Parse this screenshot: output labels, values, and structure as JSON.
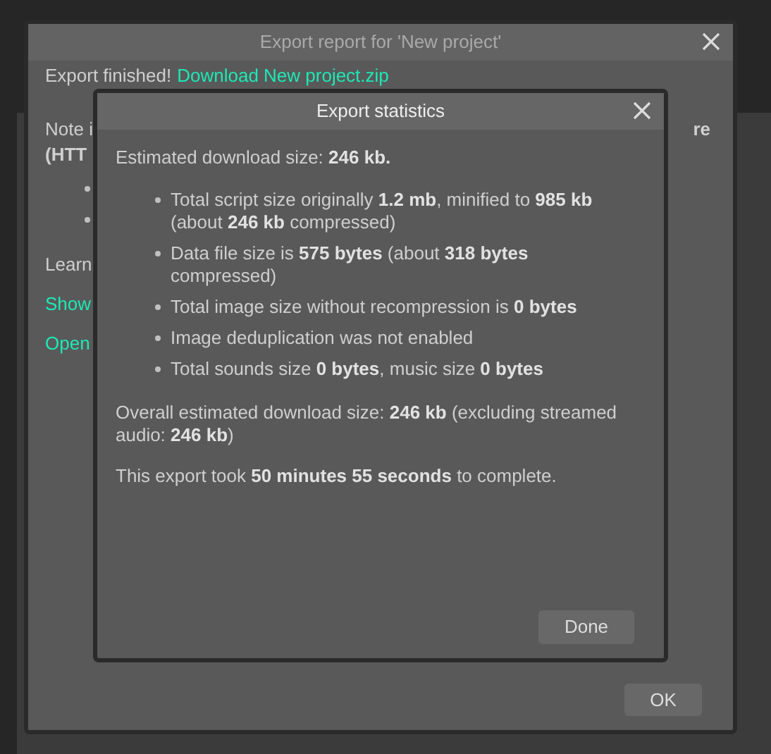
{
  "background_window": {
    "title": "Export report for 'New project'",
    "finished_text": "Export finished!",
    "download_link": "Download New project.zip",
    "note_left": "Note i",
    "note_right": "re",
    "note_line2": "(HTT",
    "learn_text": "Learn",
    "links": [
      "Show",
      "Open"
    ],
    "ok_button": "OK"
  },
  "dialog": {
    "title": "Export statistics",
    "estimate": "Estimated download size: **246 kb.**",
    "bullets": [
      "Total script size originally **1.2 mb**, minified to **985 kb** (about **246 kb** compressed)",
      "Data file size is **575 bytes** (about **318 bytes** compressed)",
      "Total image size without recompression is **0 bytes**",
      "Image deduplication was not enabled",
      "Total sounds size **0 bytes**, music size **0 bytes**"
    ],
    "overall": "Overall estimated download size: **246 kb** (excluding streamed audio: **246 kb**)",
    "duration": "This export took **50 minutes 55 seconds** to complete.",
    "done_button": "Done"
  }
}
